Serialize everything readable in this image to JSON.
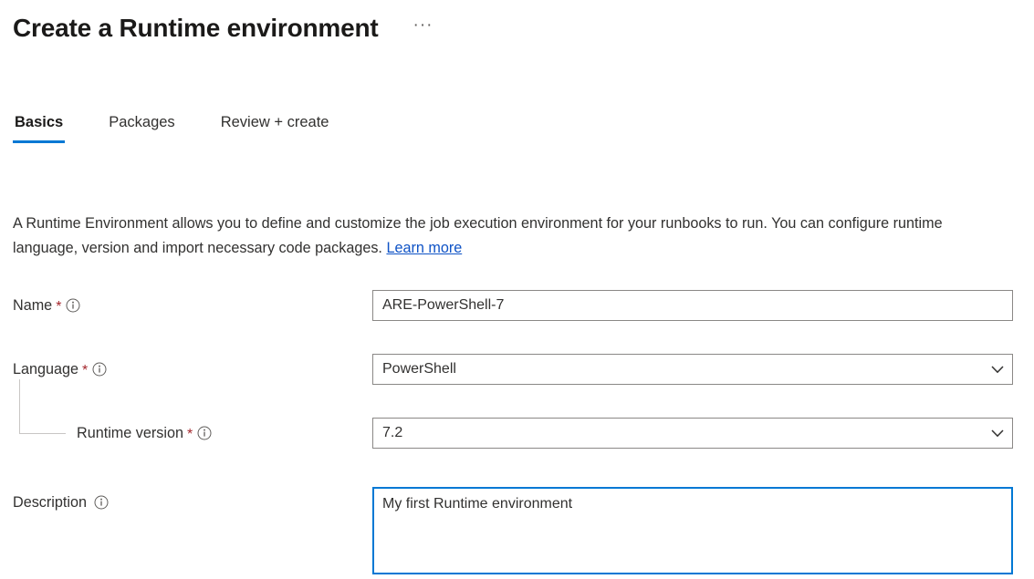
{
  "header": {
    "title": "Create a Runtime environment",
    "more_menu": "···"
  },
  "tabs": [
    {
      "label": "Basics",
      "active": true
    },
    {
      "label": "Packages",
      "active": false
    },
    {
      "label": "Review + create",
      "active": false
    }
  ],
  "intro": {
    "text": "A Runtime Environment allows you to define and customize the job execution environment for your runbooks to run. You can configure runtime language, version and import necessary code packages.",
    "link_label": "Learn more"
  },
  "form": {
    "name": {
      "label": "Name",
      "required_marker": "*",
      "value": "ARE-PowerShell-7",
      "placeholder": ""
    },
    "language": {
      "label": "Language",
      "required_marker": "*",
      "value": "PowerShell"
    },
    "runtime_version": {
      "label": "Runtime version",
      "required_marker": "*",
      "value": "7.2"
    },
    "description": {
      "label": "Description",
      "value": "My first Runtime environment",
      "placeholder": ""
    }
  },
  "colors": {
    "accent": "#0078d4",
    "required": "#a4262c",
    "link": "#0f53c6",
    "border": "#8a8886",
    "text": "#323130"
  }
}
